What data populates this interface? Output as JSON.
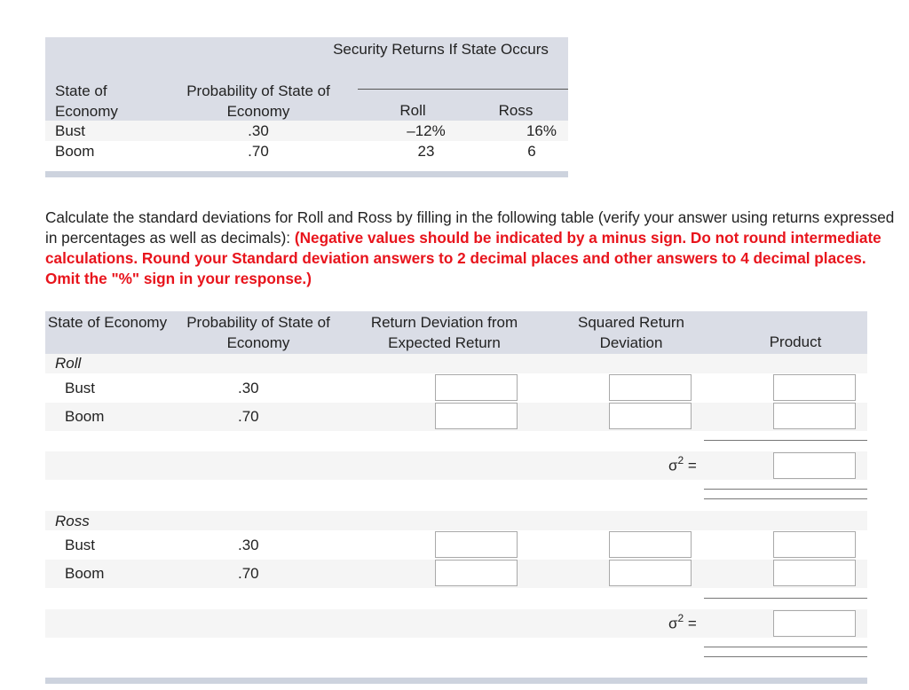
{
  "given_table": {
    "header_group": "Security Returns If State Occurs",
    "columns": [
      "State of Economy",
      "Probability of State of Economy",
      "Roll",
      "Ross"
    ],
    "rows": [
      {
        "state": "Bust",
        "probability": ".30",
        "roll": "–12%",
        "ross": "16%"
      },
      {
        "state": "Boom",
        "probability": ".70",
        "roll": "23",
        "ross": "6"
      }
    ]
  },
  "instructions": {
    "prompt": "Calculate the standard deviations for Roll and Ross by filling in the following table (verify your answer using returns expressed in percentages as well as decimals):",
    "emphasis": "(Negative values should be indicated by a minus sign. Do not round intermediate calculations. Round your Standard deviation answers to 2 decimal places and other answers to 4 decimal places. Omit the \"%\" sign in your response.)",
    "accent_color": "#e8141c"
  },
  "answer_table": {
    "columns": [
      "State of Economy",
      "Probability of State of Economy",
      "Return Deviation from Expected Return",
      "Squared Return Deviation",
      "Product"
    ],
    "sections": [
      {
        "name": "Roll",
        "rows": [
          {
            "state": "Bust",
            "probability": ".30",
            "return_deviation": "",
            "squared_deviation": "",
            "product": ""
          },
          {
            "state": "Boom",
            "probability": ".70",
            "return_deviation": "",
            "squared_deviation": "",
            "product": ""
          }
        ],
        "variance_label": "σ",
        "variance_exp": "2",
        "variance_eq": "=",
        "variance_value": ""
      },
      {
        "name": "Ross",
        "rows": [
          {
            "state": "Bust",
            "probability": ".30",
            "return_deviation": "",
            "squared_deviation": "",
            "product": ""
          },
          {
            "state": "Boom",
            "probability": ".70",
            "return_deviation": "",
            "squared_deviation": "",
            "product": ""
          }
        ],
        "variance_label": "σ",
        "variance_exp": "2",
        "variance_eq": "=",
        "variance_value": ""
      }
    ]
  }
}
